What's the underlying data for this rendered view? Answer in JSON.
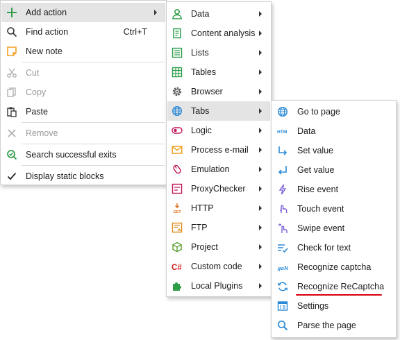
{
  "main_menu": {
    "add_action": "Add action",
    "find_action": "Find action",
    "find_action_shortcut": "Ctrl+T",
    "new_note": "New note",
    "cut": "Cut",
    "copy": "Copy",
    "paste": "Paste",
    "remove": "Remove",
    "search_successful_exits": "Search successful exits",
    "display_static_blocks": "Display static blocks"
  },
  "add_action_menu": {
    "items": [
      {
        "label": "Data",
        "icon": "person-icon"
      },
      {
        "label": "Content analysis",
        "icon": "document-icon"
      },
      {
        "label": "Lists",
        "icon": "list-icon"
      },
      {
        "label": "Tables",
        "icon": "table-icon"
      },
      {
        "label": "Browser",
        "icon": "gear-icon"
      },
      {
        "label": "Tabs",
        "icon": "globe-icon"
      },
      {
        "label": "Logic",
        "icon": "toggle-icon"
      },
      {
        "label": "Process e-mail",
        "icon": "envelope-icon"
      },
      {
        "label": "Emulation",
        "icon": "mouse-icon"
      },
      {
        "label": "ProxyChecker",
        "icon": "proxy-icon"
      },
      {
        "label": "HTTP",
        "icon": "http-get-icon"
      },
      {
        "label": "FTP",
        "icon": "ftp-icon"
      },
      {
        "label": "Project",
        "icon": "cube-icon"
      },
      {
        "label": "Custom code",
        "icon": "csharp-icon"
      },
      {
        "label": "Local Plugins",
        "icon": "puzzle-icon"
      }
    ]
  },
  "tabs_menu": {
    "items": [
      {
        "label": "Go to page",
        "icon": "globe-icon"
      },
      {
        "label": "Data",
        "icon": "html-icon"
      },
      {
        "label": "Set value",
        "icon": "arrow-down-right-icon"
      },
      {
        "label": "Get value",
        "icon": "arrow-down-left-icon"
      },
      {
        "label": "Rise event",
        "icon": "lightning-icon"
      },
      {
        "label": "Touch event",
        "icon": "touch-icon"
      },
      {
        "label": "Swipe event",
        "icon": "swipe-icon"
      },
      {
        "label": "Check for text",
        "icon": "check-list-icon"
      },
      {
        "label": "Recognize captcha",
        "icon": "captcha-icon"
      },
      {
        "label": "Recognize ReCaptcha",
        "icon": "recaptcha-icon"
      },
      {
        "label": "Settings",
        "icon": "settings-window-icon"
      },
      {
        "label": "Parse the page",
        "icon": "magnifier-icon"
      }
    ]
  },
  "colors": {
    "highlight": "#e4e4e4",
    "icon_blue": "#2a8ad8",
    "icon_green": "#2e9e4a",
    "underline_red": "#d8000a"
  }
}
